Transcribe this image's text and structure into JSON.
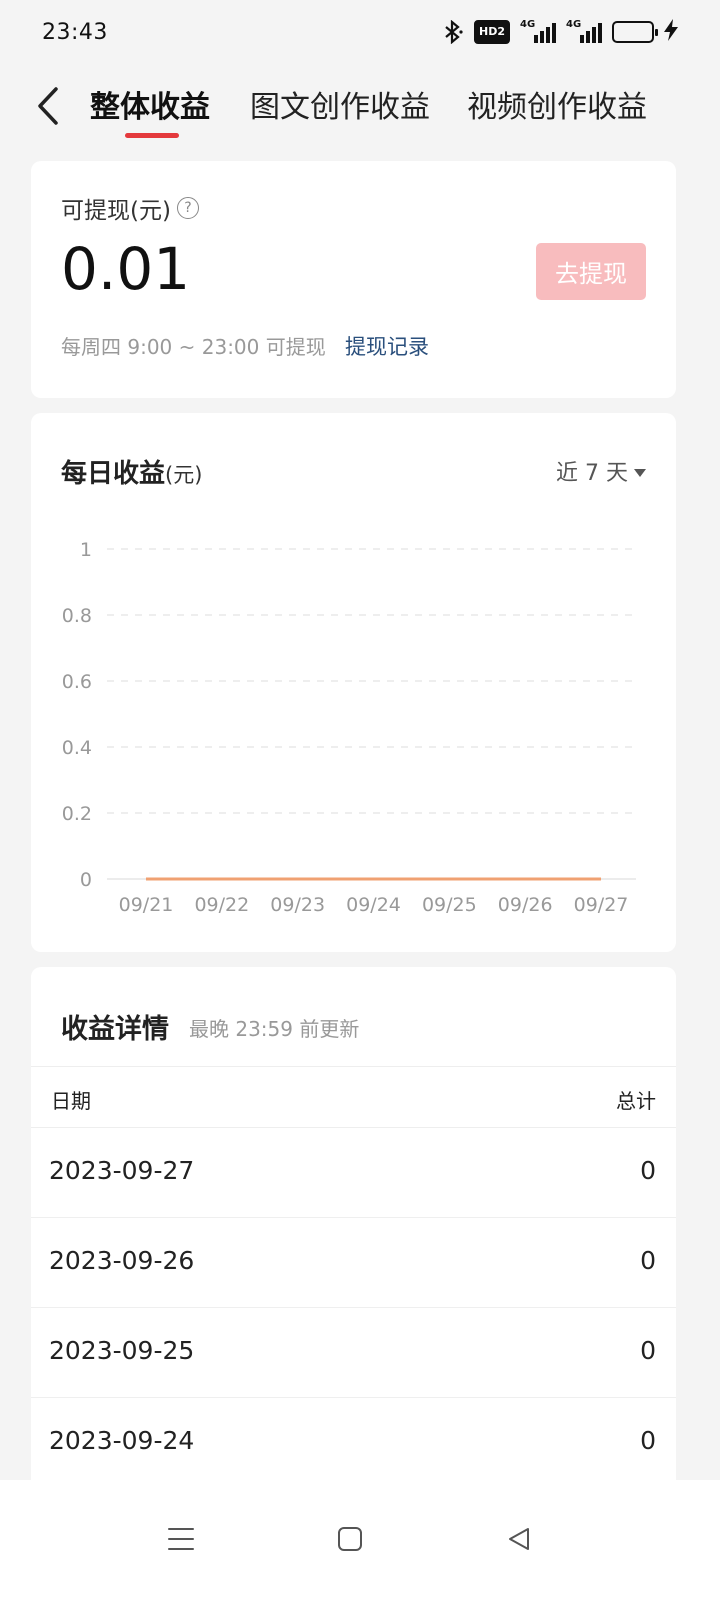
{
  "status_bar": {
    "time": "23:43",
    "hd": "HD2",
    "net1": "4G",
    "net2": "4G"
  },
  "tabs": [
    {
      "label": "整体收益",
      "active": true
    },
    {
      "label": "图文创作收益",
      "active": false
    },
    {
      "label": "视频创作收益",
      "active": false
    }
  ],
  "balance": {
    "label": "可提现(元)",
    "help": "?",
    "amount": "0.01",
    "withdraw_button": "去提现",
    "note": "每周四 9:00 ~ 23:00 可提现",
    "record_link": "提现记录"
  },
  "chart_card": {
    "title": "每日收益",
    "title_unit": "(元)",
    "range": "近 7 天"
  },
  "chart_data": {
    "type": "line",
    "categories": [
      "09/21",
      "09/22",
      "09/23",
      "09/24",
      "09/25",
      "09/26",
      "09/27"
    ],
    "values": [
      0,
      0,
      0,
      0,
      0,
      0,
      0
    ],
    "ylim": [
      0,
      1
    ],
    "yticks": [
      "0",
      "0.2",
      "0.4",
      "0.6",
      "0.8",
      "1"
    ],
    "grid": true,
    "line_color": "#f0a172"
  },
  "detail": {
    "title": "收益详情",
    "subtitle": "最晚 23:59 前更新",
    "col_date": "日期",
    "col_total": "总计",
    "rows": [
      {
        "date": "2023-09-27",
        "total": "0"
      },
      {
        "date": "2023-09-26",
        "total": "0"
      },
      {
        "date": "2023-09-25",
        "total": "0"
      },
      {
        "date": "2023-09-24",
        "total": "0"
      }
    ]
  },
  "colors": {
    "accent": "#e4393c",
    "button_disabled": "#f8bcbe",
    "link": "#2a4f7c"
  }
}
